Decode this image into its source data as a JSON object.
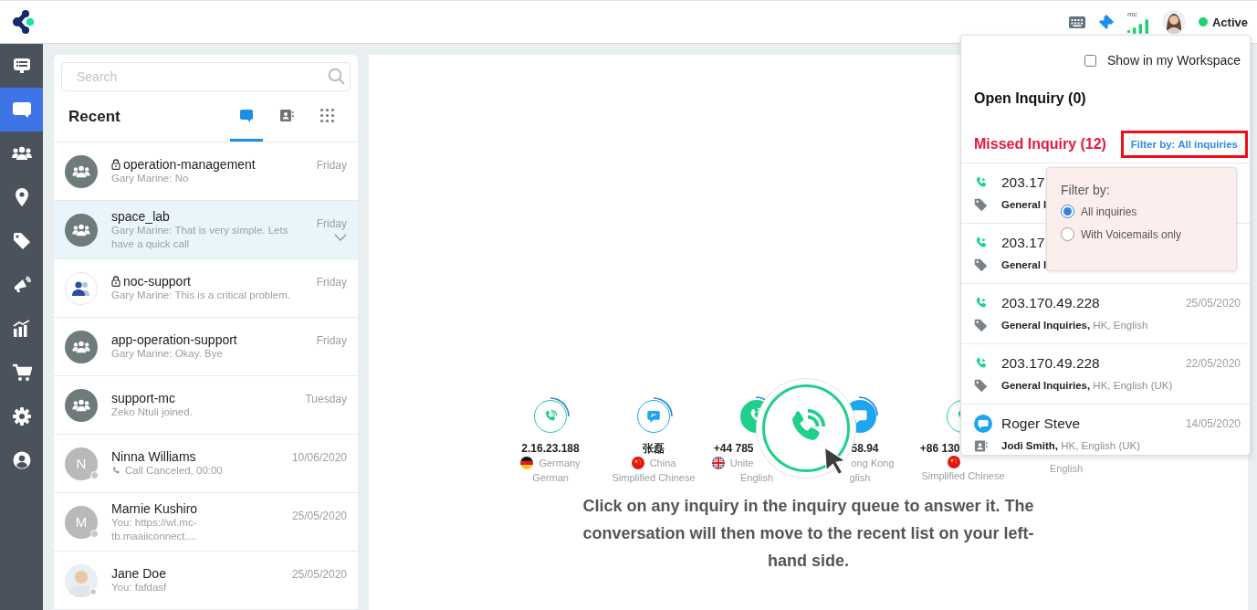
{
  "top_bar": {
    "signal_label": "mc",
    "status": {
      "label": "Active",
      "color": "#1fd26f"
    }
  },
  "nav": [
    {
      "kind": "board",
      "selected": false
    },
    {
      "kind": "chat",
      "selected": true
    },
    {
      "kind": "team",
      "selected": false
    },
    {
      "kind": "pin",
      "selected": false
    },
    {
      "kind": "tag",
      "selected": false
    },
    {
      "kind": "megaphone",
      "selected": false
    },
    {
      "kind": "chart",
      "selected": false
    },
    {
      "kind": "cart",
      "selected": false
    },
    {
      "kind": "gear",
      "selected": false
    },
    {
      "kind": "user",
      "selected": false
    }
  ],
  "recent": {
    "search": {
      "placeholder": "Search"
    },
    "title": "Recent",
    "tabs": [
      {
        "kind": "chat",
        "selected": true
      },
      {
        "kind": "contacts",
        "selected": false
      },
      {
        "kind": "apps",
        "selected": false
      }
    ],
    "conversations": [
      {
        "kind": "group",
        "locked": true,
        "name": "operation-management",
        "preview": "Gary Marine: No",
        "call_event": false,
        "time": "Friday",
        "selected": false
      },
      {
        "kind": "group",
        "locked": false,
        "name": "space_lab",
        "preview": "Gary Marine: That is very simple. Lets have a quick call",
        "call_event": false,
        "time": "Friday",
        "selected": true
      },
      {
        "kind": "team",
        "locked": true,
        "name": "noc-support",
        "preview": "Gary Marine: This is a critical problem.",
        "call_event": false,
        "time": "Friday",
        "selected": false
      },
      {
        "kind": "group",
        "locked": false,
        "name": "app-operation-support",
        "preview": "Gary Marine: Okay. Bye",
        "call_event": false,
        "time": "Friday",
        "selected": false
      },
      {
        "kind": "group",
        "locked": false,
        "name": "support-mc",
        "preview": "Zeko Ntuli joined.",
        "call_event": false,
        "time": "Tuesday",
        "selected": false
      },
      {
        "kind": "initial",
        "initial": "N",
        "locked": false,
        "name": "Ninna Williams",
        "preview": "Call Canceled, 00:00",
        "call_event": true,
        "time": "10/06/2020",
        "selected": false
      },
      {
        "kind": "initial",
        "initial": "M",
        "locked": false,
        "name": "Marnie Kushiro",
        "preview": "You: https://wl.mc-tb.maaiiconnect....",
        "call_event": false,
        "time": "25/05/2020",
        "selected": false
      },
      {
        "kind": "photo",
        "locked": false,
        "name": "Jane Doe",
        "preview": "You: fafdasf",
        "call_event": false,
        "time": "25/05/2020",
        "selected": false
      }
    ]
  },
  "queue": {
    "items": [
      {
        "kind": "call",
        "active": false,
        "title": "2.16.23.188",
        "country": {
          "kind": "de",
          "name": "Germany"
        },
        "language": "German",
        "cut_left": false,
        "cut_right": false
      },
      {
        "kind": "chat",
        "active": false,
        "title": "张磊",
        "country": {
          "kind": "cn",
          "name": "China"
        },
        "language": "Simplified Chinese",
        "cut_left": false,
        "cut_right": false
      },
      {
        "kind": "call",
        "active": true,
        "title": "+44 785",
        "country": {
          "kind": "gb",
          "name": "Unite"
        },
        "language": "English",
        "cut_left": false,
        "cut_right": true
      },
      {
        "kind": "chat",
        "active": true,
        "title": "58.94",
        "country": {
          "name": "ong Kong"
        },
        "language": "glish",
        "cut_left": true,
        "cut_right": false
      },
      {
        "kind": "call",
        "active": false,
        "title": "+86 130",
        "country": {
          "kind": "cn"
        },
        "language": "Simplified Chinese",
        "cut_left": false,
        "cut_right": true
      },
      {
        "language": "English"
      }
    ],
    "message": "Click on any inquiry in the inquiry queue to answer it. The conversation will then move to the recent list on your left-hand side."
  },
  "inquiry_panel": {
    "workspace": {
      "label": "Show in my Workspace",
      "checked": false
    },
    "open_title": "Open Inquiry (0)",
    "missed_title": "Missed Inquiry (12)",
    "filter_button": "Filter by: All inquiries",
    "filter_popover": {
      "title": "Filter by:",
      "options": [
        {
          "label": "All inquiries",
          "selected": true
        },
        {
          "label": "With Voicemails only",
          "selected": false
        }
      ]
    },
    "inquiries": [
      {
        "kind": "call",
        "title": "203.17",
        "tag_name": "General I"
      },
      {
        "kind": "call",
        "title": "203.17",
        "tag_name": "General I"
      },
      {
        "kind": "call",
        "title": "203.170.49.228",
        "date": "25/05/2020",
        "tag_name": "General Inquiries,",
        "tag_detail": "HK, English"
      },
      {
        "kind": "call",
        "title": "203.170.49.228",
        "date": "22/05/2020",
        "tag_name": "General Inquiries,",
        "tag_detail": "HK, English (UK)"
      },
      {
        "kind": "chat",
        "title": "Roger Steve",
        "date": "14/05/2020",
        "tag_name": "Jodi Smith,",
        "tag_detail": "HK, English (UK)"
      }
    ]
  }
}
